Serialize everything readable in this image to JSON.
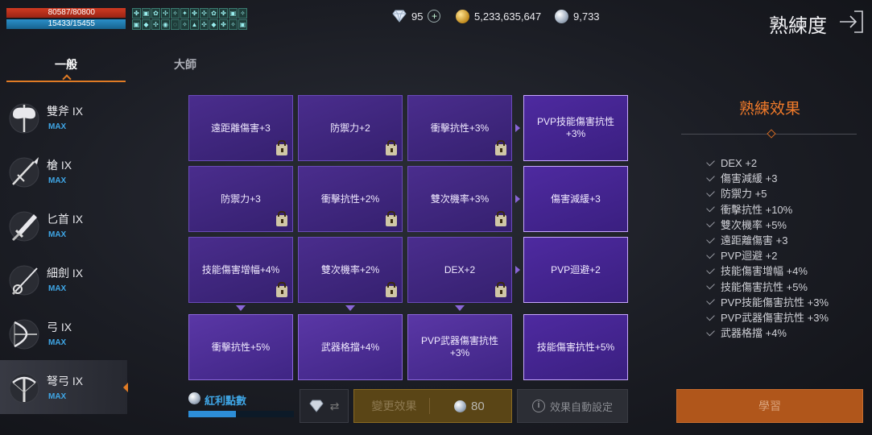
{
  "status": {
    "hp": "80587/80800",
    "mp": "15433/15455"
  },
  "buffs": [
    "✤",
    "▣",
    "✿",
    "✣",
    "✧",
    "✦",
    "✤",
    "✣",
    "✿",
    "✤",
    "▣",
    "✧",
    "▣",
    "◆",
    "✣",
    "◉",
    "◌",
    "✧",
    "▲",
    "✣",
    "◆",
    "✤",
    "✧",
    "▣"
  ],
  "currency": {
    "diamond": "95",
    "gold": "5,233,635,647",
    "shard": "9,733"
  },
  "header": {
    "title": "熟練度"
  },
  "tabs": [
    {
      "label": "一般"
    },
    {
      "label": "大師"
    }
  ],
  "weapons": [
    {
      "name": "雙斧 IX",
      "max": "MAX",
      "icon": "double-axe-icon"
    },
    {
      "name": "槍 IX",
      "max": "MAX",
      "icon": "spear-icon"
    },
    {
      "name": "匕首 IX",
      "max": "MAX",
      "icon": "dagger-icon"
    },
    {
      "name": "細劍 IX",
      "max": "MAX",
      "icon": "rapier-icon"
    },
    {
      "name": "弓 IX",
      "max": "MAX",
      "icon": "bow-icon"
    },
    {
      "name": "弩弓 IX",
      "max": "MAX",
      "icon": "crossbow-icon"
    }
  ],
  "grid": [
    [
      "遠距離傷害+3",
      "防禦力+2",
      "衝擊抗性+3%",
      "PVP技能傷害抗性+3%"
    ],
    [
      "防禦力+3",
      "衝擊抗性+2%",
      "雙次機率+3%",
      "傷害減緩+3"
    ],
    [
      "技能傷害增幅+4%",
      "雙次機率+2%",
      "DEX+2",
      "PVP迴避+2"
    ],
    [
      "衝擊抗性+5%",
      "武器格擋+4%",
      "PVP武器傷害抗性+3%",
      "技能傷害抗性+5%"
    ]
  ],
  "effects": {
    "title": "熟練效果",
    "items": [
      "DEX +2",
      "傷害減緩 +3",
      "防禦力 +5",
      "衝擊抗性 +10%",
      "雙次機率 +5%",
      "遠距離傷害 +3",
      "PVP迴避 +2",
      "技能傷害增幅 +4%",
      "技能傷害抗性 +5%",
      "PVP技能傷害抗性 +3%",
      "PVP武器傷害抗性 +3%",
      "武器格擋 +4%"
    ]
  },
  "bonus": {
    "label": "紅利點數",
    "progress": 0.45
  },
  "buttons": {
    "change": "變更效果",
    "change_cost": "80",
    "auto": "效果自動設定",
    "learn": "學習"
  },
  "colors": {
    "accent": "#e07b25",
    "card": "#4b2c95",
    "max": "#3fa6e6"
  }
}
